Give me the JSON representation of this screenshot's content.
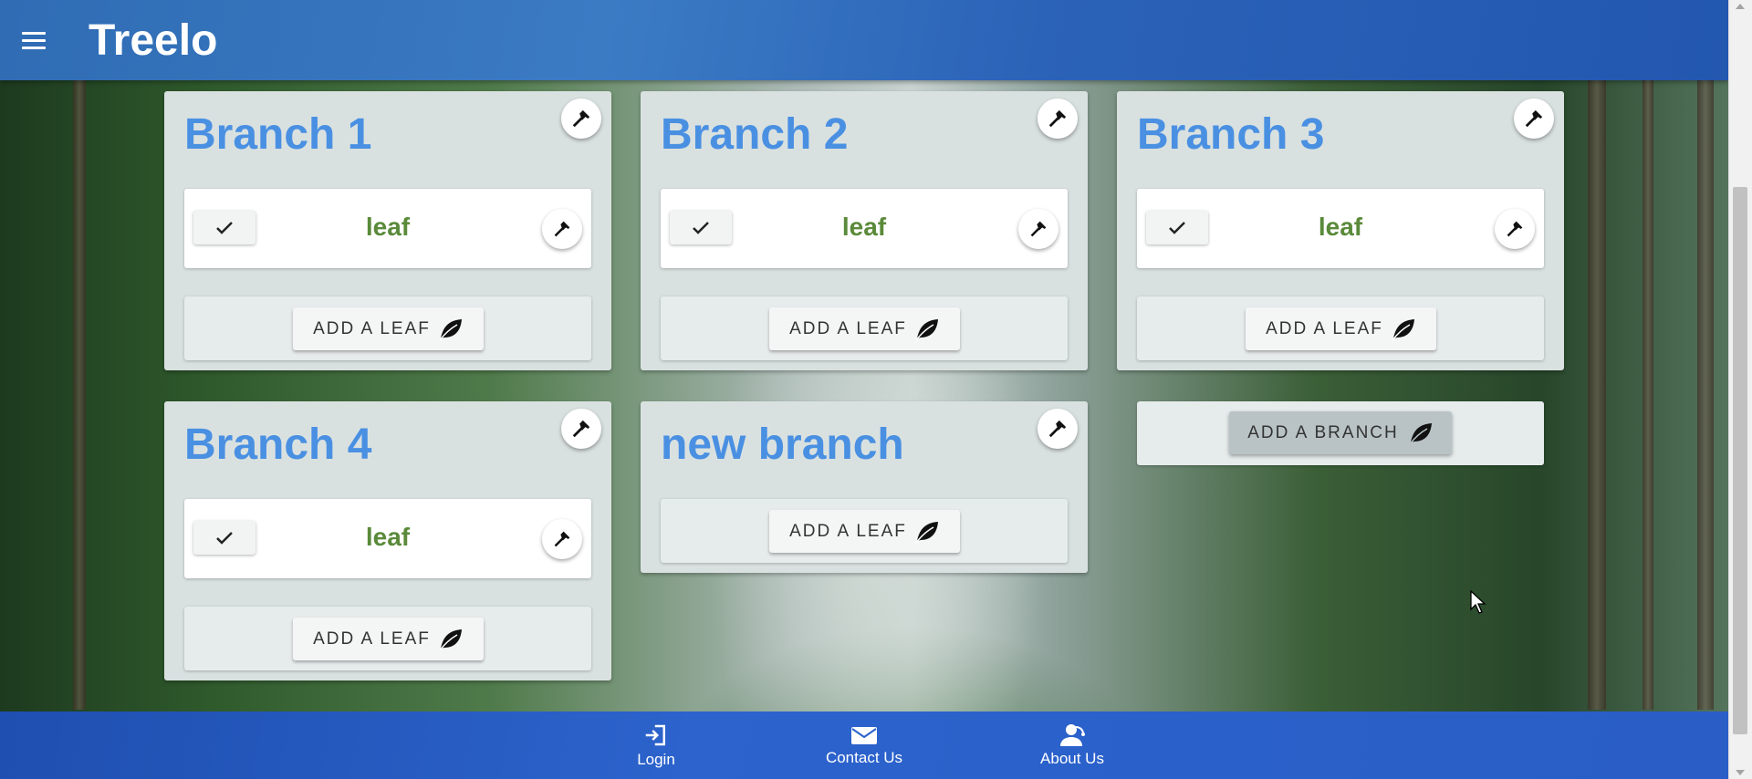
{
  "app": {
    "title": "Treelo"
  },
  "branches": [
    {
      "title": "Branch 1",
      "leaves": [
        {
          "text": "leaf"
        }
      ],
      "add_leaf_label": "ADD A LEAF"
    },
    {
      "title": "Branch 2",
      "leaves": [
        {
          "text": "leaf"
        }
      ],
      "add_leaf_label": "ADD A LEAF"
    },
    {
      "title": "Branch 3",
      "leaves": [
        {
          "text": "leaf"
        }
      ],
      "add_leaf_label": "ADD A LEAF"
    },
    {
      "title": "Branch 4",
      "leaves": [
        {
          "text": "leaf"
        }
      ],
      "add_leaf_label": "ADD A LEAF"
    },
    {
      "title": "new branch",
      "leaves": [],
      "add_leaf_label": "ADD A LEAF"
    }
  ],
  "add_branch_label": "ADD A BRANCH",
  "footer": {
    "items": [
      {
        "label": "Login",
        "icon": "login-icon"
      },
      {
        "label": "Contact Us",
        "icon": "mail-icon"
      },
      {
        "label": "About Us",
        "icon": "support-agent-icon"
      }
    ]
  },
  "colors": {
    "app_bar": "#3b7bc4",
    "branch_title": "#4a90e2",
    "leaf_text": "#5a8a3a",
    "footer": "#2c63cc"
  }
}
